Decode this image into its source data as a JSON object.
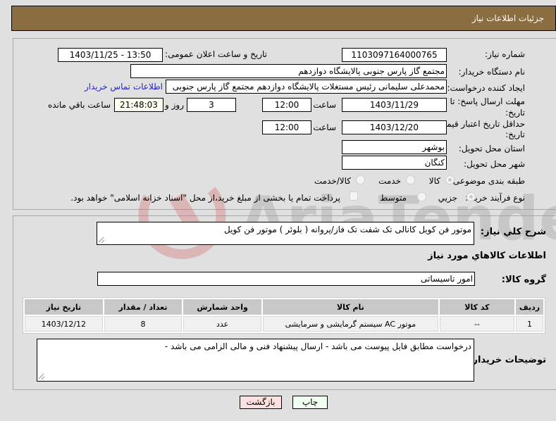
{
  "header": {
    "title": "جزئیات اطلاعات نیاز"
  },
  "form": {
    "need_number_label": "شماره نیاز:",
    "need_number": "1103097164000765",
    "announce_label": "تاریخ و ساعت اعلان عمومی:",
    "announce_value": "1403/11/25 - 13:50",
    "buyer_org_label": "نام دستگاه خریدار:",
    "buyer_org": "مجتمع گاز پارس جنوبی  پالایشگاه دوازدهم",
    "creator_label": "ایجاد کننده درخواست:",
    "creator": "محمدعلی سلیمانی رئیس مستغلات پالایشگاه دوازدهم مجتمع گاز پارس جنوبی",
    "contact_link": "اطلاعات تماس خریدار",
    "reply_deadline_label_1": "مهلت ارسال پاسخ: تا",
    "reply_deadline_label_2": "تاریخ:",
    "reply_date": "1403/11/29",
    "time_label": "ساعت",
    "reply_time": "12:00",
    "days_value": "3",
    "days_label": "روز و",
    "remaining_time": "21:48:03",
    "remaining_label": "ساعت باقي مانده",
    "price_validity_label_1": "حداقل تاریخ اعتبار قیمت: تا",
    "price_validity_label_2": "تاریخ:",
    "price_date": "1403/12/20",
    "price_time": "12:00",
    "province_label": "استان محل تحویل:",
    "province": "بوشهر",
    "city_label": "شهر محل تحویل:",
    "city": "کنگان",
    "category_label": "طبقه بندی موضوعی:",
    "category_options": [
      "کالا",
      "خدمت",
      "کالا/خدمت"
    ],
    "category_selected": "کالا",
    "process_label": "نوع فرآیند خرید :",
    "process_options": [
      "جزیي",
      "متوسط"
    ],
    "process_selected": "جزیي",
    "treasury_note": "پرداخت تمام یا بخشی از مبلغ خرید،از محل \"اسناد خزانه اسلامی\" خواهد بود."
  },
  "details": {
    "summary_label": "شرح کلي نیاز:",
    "summary": "موتور فن کویل کانالی تک شفت تک فاز/پروانه ( بلوئر ) موتور فن کویل",
    "items_heading": "اطلاعات کالاهاي مورد نیاز",
    "group_label": "گروه کالا:",
    "group": "امور تاسیساتی",
    "table": {
      "headers": [
        "ردیف",
        "کد کالا",
        "نام کالا",
        "واحد شمارش",
        "تعداد / مقدار",
        "تاریخ نیاز"
      ],
      "rows": [
        [
          "1",
          "--",
          "موتور AC سیستم گرمایشی و سرمایشی",
          "عدد",
          "8",
          "1403/12/12"
        ]
      ]
    },
    "buyer_notes_label": "توضیحات خریدار:",
    "buyer_notes": "درخواست مطابق فایل پیوست می باشد - ارسال پیشنهاد فنی و مالی الزامی می باشد -"
  },
  "buttons": {
    "print": "چاپ",
    "back": "بازگشت"
  },
  "watermark": {
    "text": "AriaTender.neT"
  },
  "colors": {
    "header_bg": "#8b6d42",
    "link": "#2323c8",
    "print_bg": "#f0fff0",
    "back_bg": "#ffe0e0"
  }
}
